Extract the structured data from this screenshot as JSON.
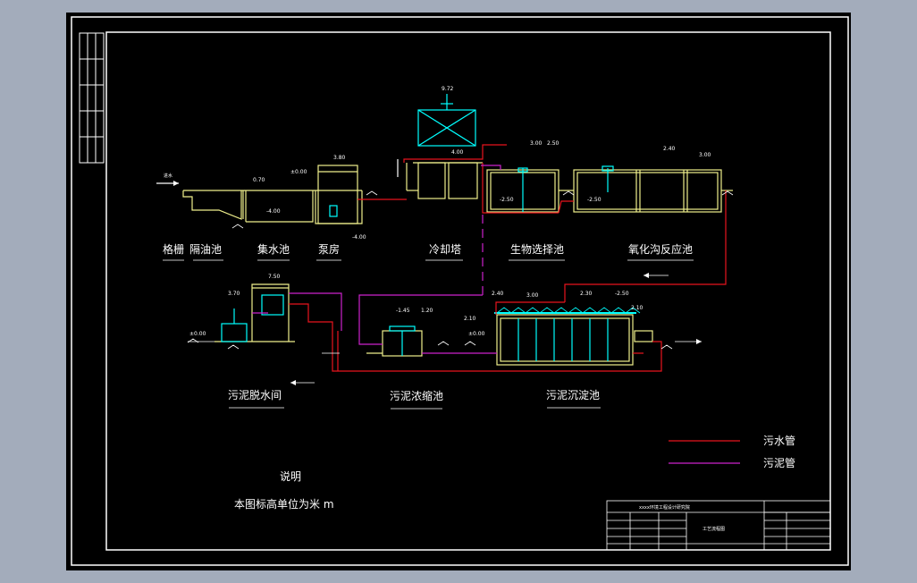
{
  "units_note": [
    "说明",
    "本图标高单位为米 m"
  ],
  "legend": [
    {
      "label": "污水管",
      "color": "#e8141e"
    },
    {
      "label": "污泥管",
      "color": "#cc22cc"
    }
  ],
  "stages_top": [
    "格栅",
    "隔油池",
    "集水池",
    "泵房",
    "冷却塔",
    "生物选择池",
    "氧化沟反应池"
  ],
  "stages_bottom": [
    "污泥脱水间",
    "污泥浓缩池",
    "污泥沉淀池"
  ],
  "elevations": {
    "cooling_tower_top": "9.72",
    "pump_room": "3.80",
    "sep_0": "0.70",
    "collect_zero": "±0.00",
    "collect_low": "-4.00",
    "pump_low": "-4.00",
    "tower_water": "4.00",
    "selector_a": "3.00",
    "selector_b": "2.50",
    "selector_low": "-2.50",
    "selector_low2": "-2.50",
    "oxid_a": "2.40",
    "oxid_b": "3.00",
    "dewater_top": "7.50",
    "dewater_mid": "3.70",
    "dewater_zero": "±0.00",
    "thick_a": "-1.45",
    "thick_b": "1.20",
    "thick_c": "2.10",
    "thick_zero": "±0.00",
    "sed_a": "2.40",
    "sed_b": "3.00",
    "sed_c": "2.30",
    "sed_d": "-2.50",
    "sed_e": "2.10"
  },
  "title_block": {
    "header": "xxxx环境工程设计研究院",
    "drawing": "工艺流程图"
  },
  "colors": {
    "page": "#a3acbb",
    "sheet": "#000000",
    "border": "#ffffff",
    "structure": "#f0f08c",
    "equipment": "#00ffff",
    "sewage": "#e8141e",
    "sludge": "#cc22cc"
  }
}
